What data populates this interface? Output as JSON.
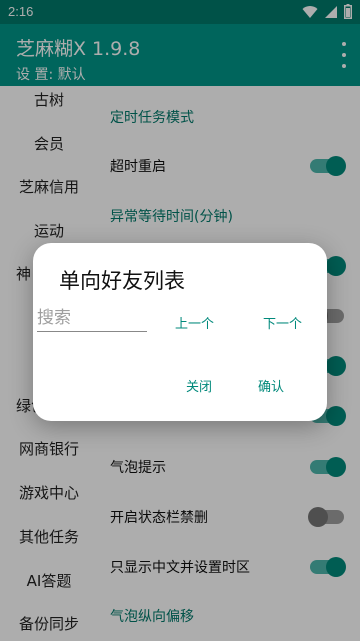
{
  "status_bar": {
    "time": "2:16",
    "icons": [
      "wifi-icon",
      "signal-icon",
      "battery-icon"
    ]
  },
  "app_bar": {
    "title": "芝麻糊X 1.9.8",
    "subtitle": "设 置: 默认",
    "menu_icon": "more-vert-icon"
  },
  "sidebar": {
    "items": [
      {
        "label": "古树"
      },
      {
        "label": "会员"
      },
      {
        "label": "芝麻信用"
      },
      {
        "label": "运动"
      },
      {
        "label": "神"
      },
      {
        "label": "绿色"
      },
      {
        "label": "网商银行"
      },
      {
        "label": "游戏中心"
      },
      {
        "label": "其他任务"
      },
      {
        "label": "AI答题"
      },
      {
        "label": "备份同步"
      }
    ]
  },
  "settings": {
    "rows": [
      {
        "label": "定时任务模式",
        "type": "header"
      },
      {
        "label": "超时重启",
        "type": "switch",
        "on": true
      },
      {
        "label": "异常等待时间(分钟)",
        "type": "header"
      },
      {
        "label": "",
        "type": "switch",
        "on": true
      },
      {
        "label": "",
        "type": "switch",
        "on": false
      },
      {
        "label": "",
        "type": "switch",
        "on": true
      },
      {
        "label": "",
        "type": "switch",
        "on": true
      },
      {
        "label": "气泡提示",
        "type": "switch",
        "on": true
      },
      {
        "label": "开启状态栏禁删",
        "type": "switch",
        "on": false
      },
      {
        "label": "只显示中文并设置时区",
        "type": "switch",
        "on": true
      },
      {
        "label": "气泡纵向偏移",
        "type": "header"
      }
    ]
  },
  "dialog": {
    "title": "单向好友列表",
    "search_placeholder": "搜索",
    "prev_label": "上一个",
    "next_label": "下一个",
    "close_label": "关闭",
    "confirm_label": "确认"
  },
  "colors": {
    "primary": "#009688",
    "primary_dark": "#00796b",
    "accent": "#00897b"
  }
}
